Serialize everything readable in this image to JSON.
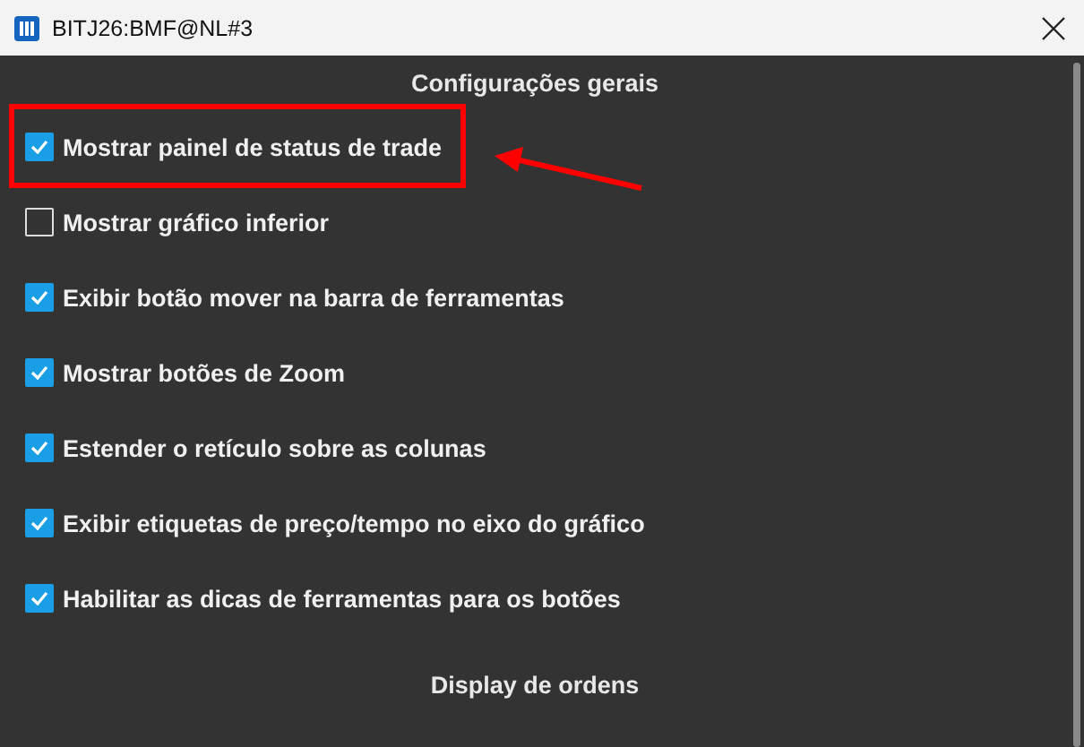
{
  "window": {
    "title": "BITJ26:BMF@NL#3"
  },
  "sections": [
    {
      "title": "Configurações gerais",
      "options": [
        {
          "label": "Mostrar painel de status de trade",
          "checked": true,
          "highlighted": true
        },
        {
          "label": "Mostrar gráfico inferior",
          "checked": false,
          "highlighted": false
        },
        {
          "label": "Exibir botão mover na barra de ferramentas",
          "checked": true,
          "highlighted": false
        },
        {
          "label": "Mostrar botões de Zoom",
          "checked": true,
          "highlighted": false
        },
        {
          "label": "Estender o retículo sobre as colunas",
          "checked": true,
          "highlighted": false
        },
        {
          "label": "Exibir etiquetas de preço/tempo no eixo do gráfico",
          "checked": true,
          "highlighted": false
        },
        {
          "label": "Habilitar as dicas de ferramentas para os botões",
          "checked": true,
          "highlighted": false
        }
      ]
    },
    {
      "title": "Display de ordens"
    }
  ]
}
